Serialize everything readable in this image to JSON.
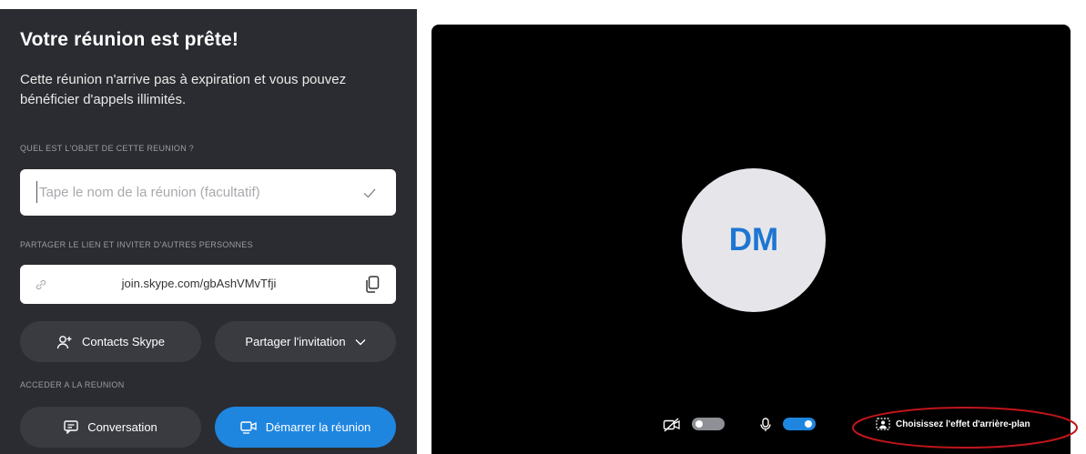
{
  "left": {
    "title": "Votre réunion est prête!",
    "subtitle": "Cette réunion n'arrive pas à expiration et vous pouvez bénéficier d'appels illimités.",
    "topic_label": "QUEL EST L'OBJET DE CETTE REUNION ?",
    "topic_placeholder": "Tape le nom de la réunion (facultatif)",
    "topic_value": "",
    "share_label": "PARTAGER LE LIEN ET INVITER D'AUTRES PERSONNES",
    "link": "join.skype.com/gbAshVMvTfji",
    "contacts_button": "Contacts Skype",
    "share_button": "Partager l'invitation",
    "join_label": "ACCEDER A LA REUNION",
    "conversation_button": "Conversation",
    "start_button": "Démarrer la réunion"
  },
  "video": {
    "avatar_initials": "DM",
    "camera_on": false,
    "mic_on": true,
    "background_effect": "Choisissez l'effet d'arrière-plan"
  },
  "colors": {
    "panel_bg": "#2b2c31",
    "pill_bg": "#3a3b41",
    "accent": "#1f86e0",
    "highlight": "#c0151b"
  },
  "icons": [
    "check-icon",
    "link-icon",
    "copy-icon",
    "add-contact-icon",
    "chevron-down-icon",
    "chat-icon",
    "video-start-icon",
    "camera-off-icon",
    "mic-icon",
    "background-effect-icon"
  ]
}
